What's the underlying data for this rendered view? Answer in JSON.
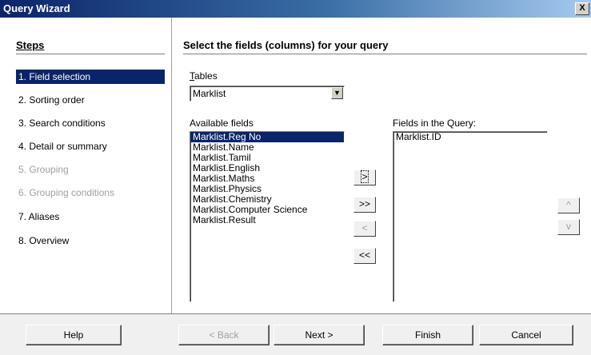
{
  "window": {
    "title": "Query Wizard",
    "close_label": "X"
  },
  "steps": {
    "heading": "Steps",
    "items": [
      {
        "label": "1.  Field selection",
        "state": "active"
      },
      {
        "label": "2.  Sorting order",
        "state": "normal"
      },
      {
        "label": "3.  Search conditions",
        "state": "normal"
      },
      {
        "label": "4.  Detail or summary",
        "state": "normal"
      },
      {
        "label": "5.  Grouping",
        "state": "disabled"
      },
      {
        "label": "6.  Grouping conditions",
        "state": "disabled"
      },
      {
        "label": "7.  Aliases",
        "state": "normal"
      },
      {
        "label": "8.  Overview",
        "state": "normal"
      }
    ]
  },
  "main": {
    "heading": "Select the fields (columns) for your query",
    "tables_label": "Tables",
    "tables_value": "Marklist",
    "available_label": "Available fields",
    "available_fields": [
      "Marklist.Reg No",
      "Marklist.Name",
      "Marklist.Tamil",
      "Marklist.English",
      "Marklist.Maths",
      "Marklist.Physics",
      "Marklist.Chemistry",
      "Marklist.Computer Science",
      "Marklist.Result"
    ],
    "selected_available_index": 0,
    "query_label": "Fields in the Query:",
    "query_fields": [
      "Marklist.ID"
    ],
    "move_buttons": [
      ">",
      ">>",
      "<",
      "<<"
    ],
    "order_buttons": [
      "^",
      "v"
    ]
  },
  "footer": {
    "help": "Help",
    "back": "< Back",
    "next": "Next >",
    "finish": "Finish",
    "cancel": "Cancel"
  }
}
